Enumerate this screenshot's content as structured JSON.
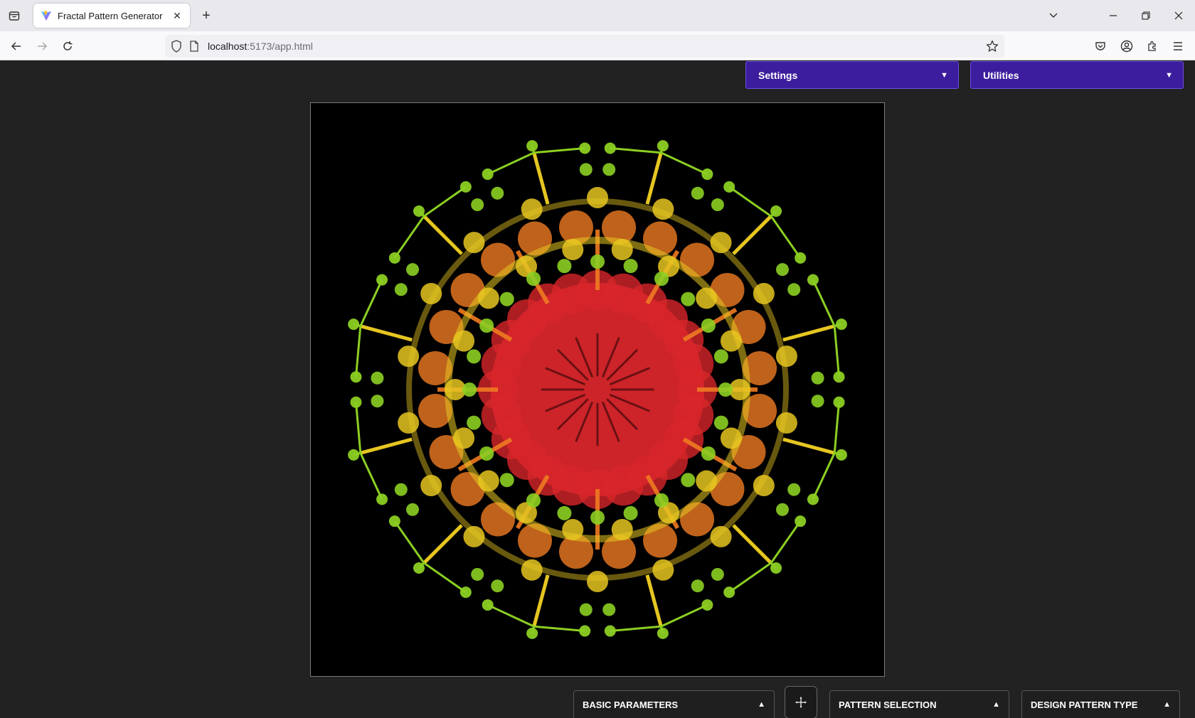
{
  "browser": {
    "tab_title": "Fractal Pattern Generator",
    "url_host": "localhost",
    "url_rest": ":5173/app.html"
  },
  "app": {
    "settings_label": "Settings",
    "utilities_label": "Utilities",
    "dropdown_arrow": "▼",
    "panel_arrow": "▲",
    "panels": {
      "basic": "BASIC PARAMETERS",
      "pattern": "PATTERN SELECTION",
      "design": "DESIGN PATTERN TYPE"
    },
    "accent_color": "#3c1d9d",
    "fractal_colors": {
      "core": "#d7262b",
      "mid": "#ef7a22",
      "outer": "#e6c621",
      "tips": "#8ccf22"
    }
  }
}
